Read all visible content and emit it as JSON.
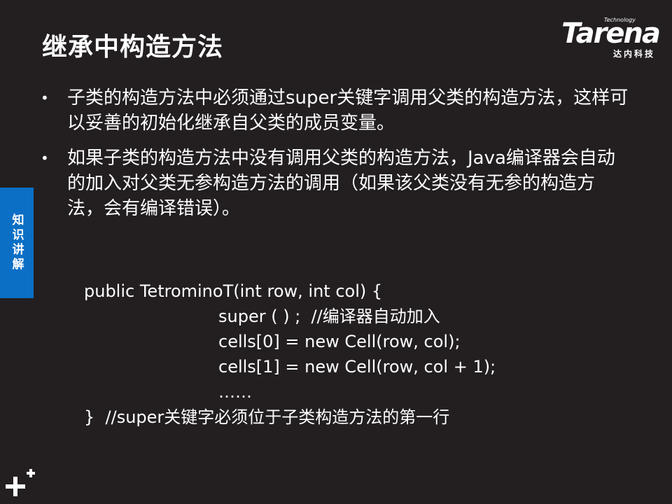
{
  "slide": {
    "title": "继承中构造方法",
    "side_tab": "知识讲解"
  },
  "logo": {
    "tech": "Technology",
    "word": "Tarena",
    "sub": "达内科技"
  },
  "bullets": [
    "子类的构造方法中必须通过super关键字调用父类的构造方法，这样可以妥善的初始化继承自父类的成员变量。",
    "如果子类的构造方法中没有调用父类的构造方法，Java编译器会自动的加入对父类无参构造方法的调用（如果该父类没有无参的构造方法，会有编译错误）。"
  ],
  "code": {
    "line1": "public TetrominoT(int row, int col) {",
    "line2": "super ( ) ;  //编译器自动加入",
    "line3": "cells[0] = new Cell(row, col);",
    "line4": "cells[1] = new Cell(row, col + 1);",
    "line5": "……",
    "line6": "}  //super关键字必须位于子类构造方法的第一行"
  },
  "colors": {
    "background": "#231f20",
    "side_tab": "#0b6fc5",
    "text": "#ffffff"
  },
  "icons": {
    "bullet": "bullet-dot-icon",
    "corner": "plus-icon"
  }
}
